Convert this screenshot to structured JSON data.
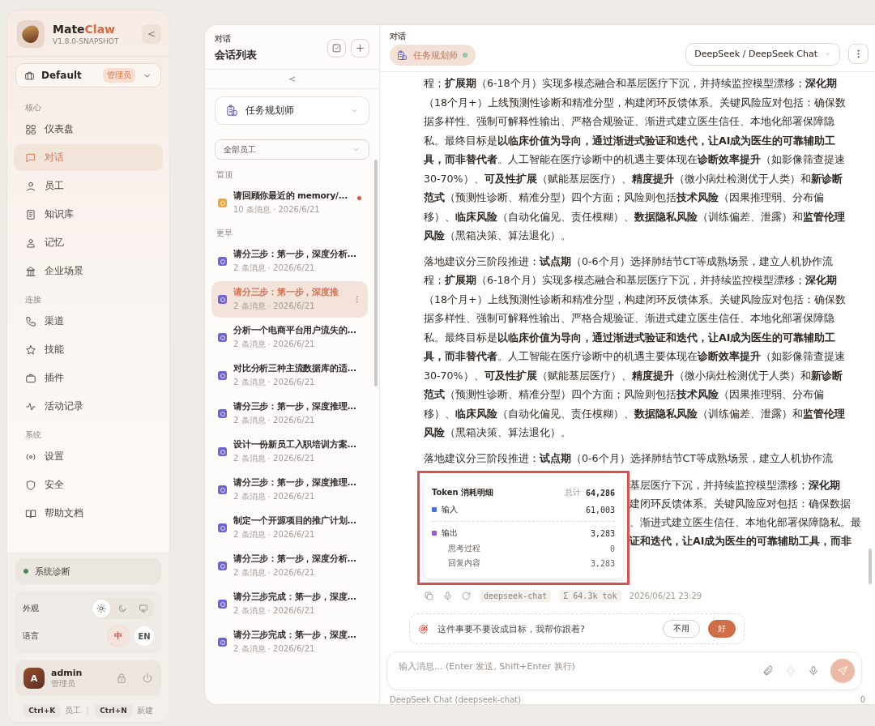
{
  "sidebar": {
    "app_name": {
      "first": "Mate",
      "second": "Claw"
    },
    "version": "V1.8.0-SNAPSHOT",
    "collapse": "<",
    "workspace": {
      "name": "Default",
      "badge": "管理员"
    },
    "sections": [
      {
        "label": "核心",
        "items": [
          {
            "label": "仪表盘",
            "selected": false
          },
          {
            "label": "对话",
            "selected": true
          },
          {
            "label": "员工",
            "selected": false
          },
          {
            "label": "知识库",
            "selected": false
          },
          {
            "label": "记忆",
            "selected": false
          },
          {
            "label": "企业场景",
            "selected": false
          }
        ]
      },
      {
        "label": "连接",
        "items": [
          {
            "label": "渠道",
            "selected": false
          },
          {
            "label": "技能",
            "selected": false
          },
          {
            "label": "插件",
            "selected": false
          },
          {
            "label": "活动记录",
            "selected": false
          }
        ]
      },
      {
        "label": "系统",
        "items": [
          {
            "label": "设置",
            "selected": false
          },
          {
            "label": "安全",
            "selected": false
          },
          {
            "label": "帮助文档",
            "selected": false
          }
        ]
      }
    ],
    "diagnostics": {
      "label": "系统诊断",
      "color": "#4f8a5b"
    },
    "appearance": {
      "label": "外观",
      "options": [
        {
          "kind": "light",
          "selected": true
        },
        {
          "kind": "dark",
          "selected": false
        },
        {
          "kind": "system",
          "selected": false
        }
      ]
    },
    "language": {
      "label": "语言",
      "options": [
        {
          "label": "中",
          "selected": true
        },
        {
          "label": "EN",
          "selected": false
        }
      ]
    },
    "user": {
      "initial": "A",
      "name": "admin",
      "role": "管理员"
    },
    "shortcuts": [
      {
        "keys": "Ctrl+K",
        "label": "员工"
      },
      {
        "keys": "Ctrl+N",
        "label": "新建"
      }
    ]
  },
  "conversation_list": {
    "eyebrow": "对话",
    "title": "会话列表",
    "collapse": "<",
    "agent": "任务规划师",
    "filter": "全部员工",
    "groups": [
      {
        "label": "置顶",
        "items": [
          {
            "title": "请回顾你最近的 memory/...",
            "meta": "10 条消息 · 2026/6/21",
            "color": "#e8a93a",
            "unread": true,
            "selected": false
          }
        ]
      },
      {
        "label": "更早",
        "items": [
          {
            "title": "请分三步：第一步，深度分析...",
            "meta": "2 条消息 · 2026/6/21",
            "color": "#6b63d6",
            "unread": false,
            "selected": false
          },
          {
            "title": "请分三步：第一步，深度推",
            "meta": "2 条消息 · 2026/6/21",
            "color": "#6b63d6",
            "unread": false,
            "selected": true
          },
          {
            "title": "分析一个电商平台用户流失的...",
            "meta": "2 条消息 · 2026/6/21",
            "color": "#6b63d6",
            "unread": false,
            "selected": false
          },
          {
            "title": "对比分析三种主流数据库的适...",
            "meta": "2 条消息 · 2026/6/21",
            "color": "#6b63d6",
            "unread": false,
            "selected": false
          },
          {
            "title": "请分三步：第一步，深度推理...",
            "meta": "2 条消息 · 2026/6/21",
            "color": "#6b63d6",
            "unread": false,
            "selected": false
          },
          {
            "title": "设计一份新员工入职培训方案...",
            "meta": "2 条消息 · 2026/6/21",
            "color": "#6b63d6",
            "unread": false,
            "selected": false
          },
          {
            "title": "请分三步：第一步，深度推理...",
            "meta": "2 条消息 · 2026/6/21",
            "color": "#6b63d6",
            "unread": false,
            "selected": false
          },
          {
            "title": "制定一个开源项目的推广计划...",
            "meta": "2 条消息 · 2026/6/21",
            "color": "#6b63d6",
            "unread": false,
            "selected": false
          },
          {
            "title": "请分三步：第一步，深度分析...",
            "meta": "2 条消息 · 2026/6/21",
            "color": "#6b63d6",
            "unread": false,
            "selected": false
          },
          {
            "title": "请分三步完成：第一步，深度...",
            "meta": "2 条消息 · 2026/6/21",
            "color": "#6b63d6",
            "unread": false,
            "selected": false
          },
          {
            "title": "请分三步完成：第一步，深度...",
            "meta": "2 条消息 · 2026/6/21",
            "color": "#6b63d6",
            "unread": false,
            "selected": false
          }
        ]
      }
    ]
  },
  "chat": {
    "eyebrow": "对话",
    "agent": "任务规划师",
    "model": "DeepSeek / DeepSeek Chat",
    "paragraphs": [
      "程；**扩展期**（6-18个月）实现多模态融合和基层医疗下沉，并持续监控模型漂移；**深化期**（18个月+）上线预测性诊断和精准分型，构建闭环反馈体系。关键风险应对包括：确保数据多样性、强制可解释性输出、严格合规验证、渐进式建立医生信任、本地化部署保障隐私。最终目标是**以临床价值为导向，通过渐进式验证和迭代，让AI成为医生的可靠辅助工具，而非替代者**。人工智能在医疗诊断中的机遇主要体现在**诊断效率提升**（如影像筛查提速30-70%）、**可及性扩展**（赋能基层医疗）、**精度提升**（微小病灶检测优于人类）和**新诊断范式**（预测性诊断、精准分型）四个方面；风险则包括**技术风险**（因果推理弱、分布偏移）、**临床风险**（自动化偏见、责任模糊）、**数据隐私风险**（训练偏差、泄露）和**监管伦理风险**（黑箱决策、算法退化）。",
      "落地建议分三阶段推进：**试点期**（0-6个月）选择肺结节CT等成熟场景，建立人机协作流程；**扩展期**（6-18个月）实现多模态融合和基层医疗下沉，并持续监控模型漂移；**深化期**（18个月+）上线预测性诊断和精准分型，构建闭环反馈体系。关键风险应对包括：确保数据多样性、强制可解释性输出、严格合规验证、渐进式建立医生信任、本地化部署保障隐私。最终目标是**以临床价值为导向，通过渐进式验证和迭代，让AI成为医生的可靠辅助工具，而非替代者**。人工智能在医疗诊断中的机遇主要体现在**诊断效率提升**（如影像筛查提速30-70%）、**可及性扩展**（赋能基层医疗）、**精度提升**（微小病灶检测优于人类）和**新诊断范式**（预测性诊断、精准分型）四个方面；风险则包括**技术风险**（因果推理弱、分布偏移）、**临床风险**（自动化偏见、责任模糊）、**数据隐私风险**（训练偏差、泄露）和**监管伦理风险**（黑箱决策、算法退化）。",
      "落地建议分三阶段推进：**试点期**（0-6个月）选择肺结节CT等成熟场景，建立人机协作流"
    ],
    "covered_lines": [
      {
        "text": "基层医疗下沉，并持续监控模型漂移；**深化期**",
        "bold": false
      },
      {
        "text": "建闭环反馈体系。关键风险应对包括：确保数据",
        "bold": false
      },
      {
        "text": "、渐进式建立医生信任、本地化部署保障隐私。最",
        "bold": false
      },
      {
        "text": "证和迭代，让AI成为医生的可靠辅助工具，而非",
        "bold": true
      }
    ],
    "token_popup": {
      "title": "Token 消耗明细",
      "total_label": "总计",
      "total": "64,286",
      "rows": [
        {
          "label": "输入",
          "value": "61,003",
          "color": "#3f73d9",
          "sub": []
        },
        {
          "label": "输出",
          "value": "3,283",
          "color": "#9b5bd6",
          "sub": [
            {
              "label": "思考过程",
              "value": "0"
            },
            {
              "label": "回复内容",
              "value": "3,283"
            }
          ]
        }
      ]
    },
    "meta": {
      "model_tag": "deepseek-chat",
      "tokens": "Σ 64.3k tok",
      "time": "2026/06/21 23:29"
    },
    "suggestion": {
      "text": "这件事要不要设成目标，我帮你跟着?",
      "decline": "不用",
      "accept": "好"
    },
    "input": {
      "placeholder": "输入消息... (Enter 发送, Shift+Enter 换行)"
    },
    "footer": {
      "model": "DeepSeek Chat (deepseek-chat)",
      "count": "0"
    }
  }
}
